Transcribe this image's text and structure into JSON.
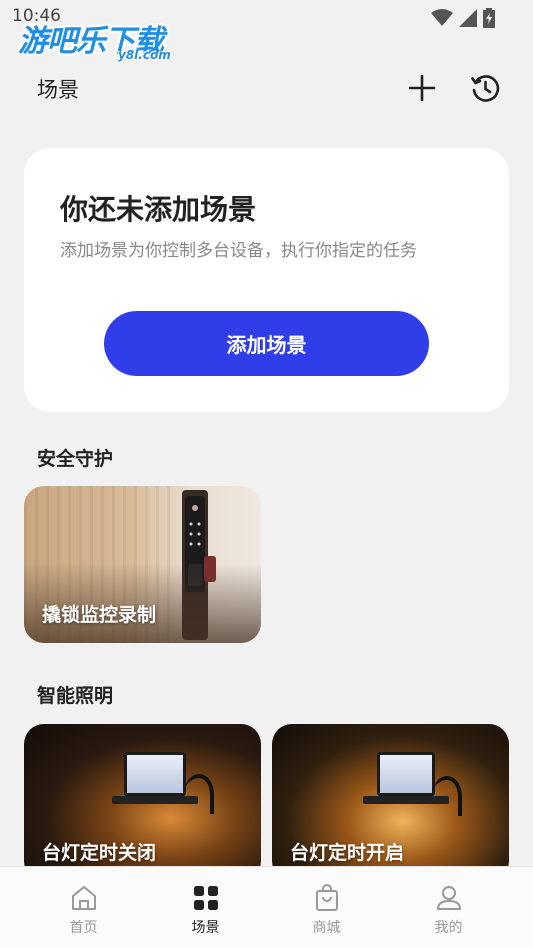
{
  "status": {
    "time": "10:46"
  },
  "watermark": {
    "main": "游吧乐下载",
    "sub": "y8l.com"
  },
  "header": {
    "title": "场景"
  },
  "empty_card": {
    "title": "你还未添加场景",
    "description": "添加场景为你控制多台设备，执行你指定的任务",
    "button_label": "添加场景"
  },
  "sections": [
    {
      "title": "安全守护",
      "tiles": [
        {
          "label": "撬锁监控录制"
        }
      ]
    },
    {
      "title": "智能照明",
      "tiles": [
        {
          "label": "台灯定时关闭"
        },
        {
          "label": "台灯定时开启"
        }
      ]
    }
  ],
  "nav": {
    "items": [
      {
        "label": "首页",
        "icon": "home-icon"
      },
      {
        "label": "场景",
        "icon": "scene-grid-icon"
      },
      {
        "label": "商城",
        "icon": "shop-bag-icon"
      },
      {
        "label": "我的",
        "icon": "profile-icon"
      }
    ],
    "active_index": 1
  },
  "colors": {
    "accent": "#2f3ee8",
    "background": "#f1f1f1",
    "card": "#ffffff"
  }
}
